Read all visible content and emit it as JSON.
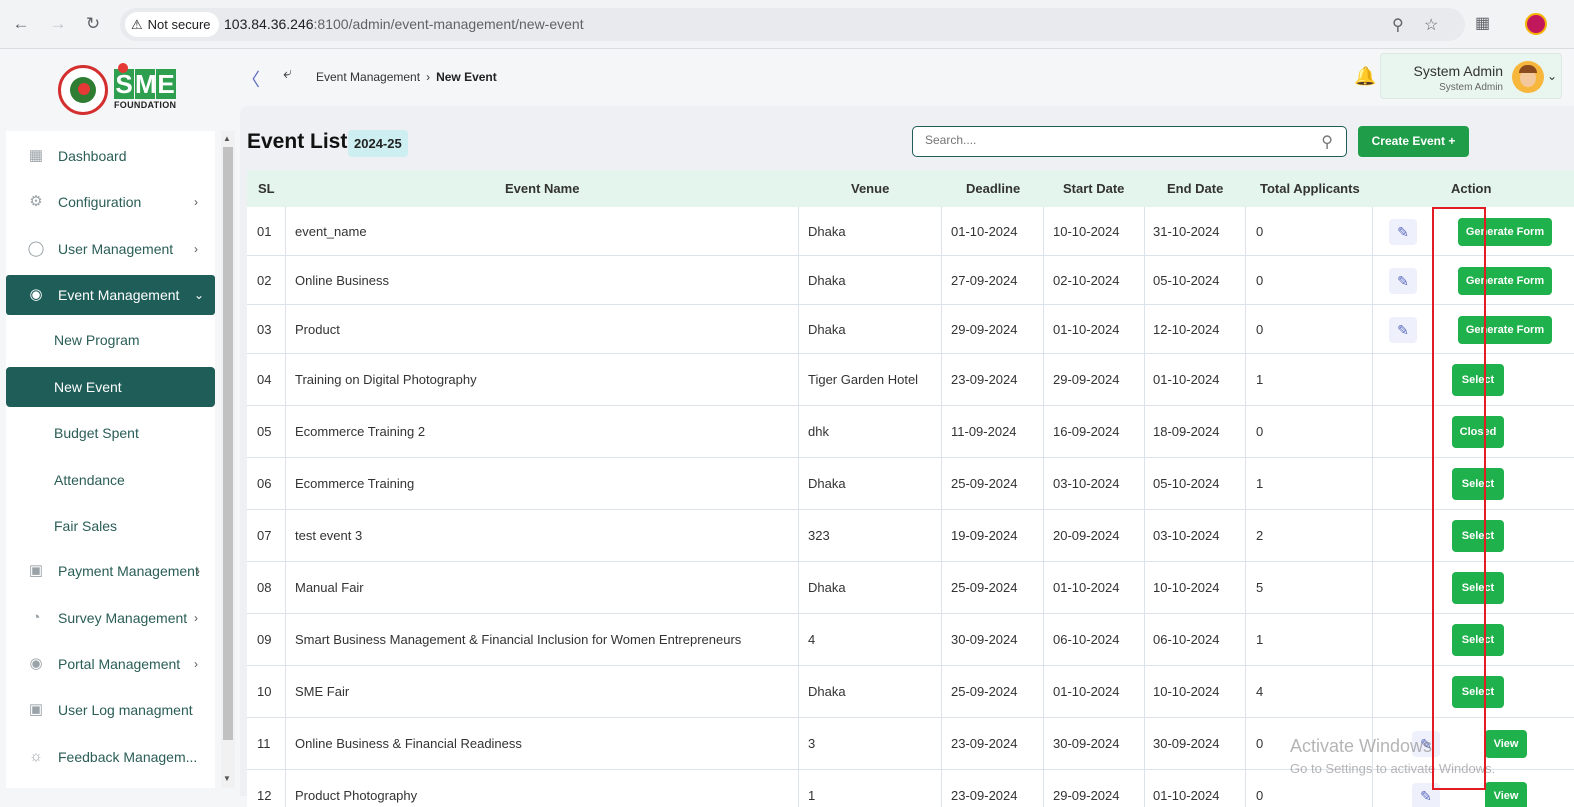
{
  "browser": {
    "security_label": "Not secure",
    "url_host": "103.84.36.246",
    "url_rest": ":8100/admin/event-management/new-event"
  },
  "brand": {
    "letters": [
      "S",
      "M",
      "E"
    ],
    "foundation": "FOUNDATION"
  },
  "header": {
    "breadcrumb_parent": "Event Management",
    "breadcrumb_current": "New Event",
    "user_name": "System Admin",
    "user_role": "System Admin"
  },
  "sidebar": {
    "items": [
      {
        "label": "Dashboard",
        "icon": "grid-icon"
      },
      {
        "label": "Configuration",
        "icon": "config-icon"
      },
      {
        "label": "User Management",
        "icon": "shield-icon"
      },
      {
        "label": "Event Management",
        "icon": "lock-icon"
      },
      {
        "label": "New Program"
      },
      {
        "label": "New Event"
      },
      {
        "label": "Budget Spent"
      },
      {
        "label": "Attendance"
      },
      {
        "label": "Fair Sales"
      },
      {
        "label": "Payment Management",
        "icon": "payment-icon"
      },
      {
        "label": "Survey Management",
        "icon": "pie-icon"
      },
      {
        "label": "Portal Management",
        "icon": "lock-icon"
      },
      {
        "label": "User Log managment",
        "icon": "log-icon"
      },
      {
        "label": "Feedback Managem...",
        "icon": "feedback-icon"
      }
    ]
  },
  "main": {
    "title": "Event List",
    "year": "2024-25",
    "search_placeholder": "Search....",
    "create_label": "Create Event +"
  },
  "table": {
    "headers": [
      "SL",
      "Event Name",
      "Venue",
      "Deadline",
      "Start Date",
      "End Date",
      "Total Applicants",
      "Action"
    ],
    "rows": [
      {
        "sl": "01",
        "name": "event_name",
        "venue": "Dhaka",
        "deadline": "01-10-2024",
        "start": "10-10-2024",
        "end": "31-10-2024",
        "applicants": "0",
        "action": "Generate Form",
        "edit": true
      },
      {
        "sl": "02",
        "name": "Online Business",
        "venue": "Dhaka",
        "deadline": "27-09-2024",
        "start": "02-10-2024",
        "end": "05-10-2024",
        "applicants": "0",
        "action": "Generate Form",
        "edit": true
      },
      {
        "sl": "03",
        "name": "Product",
        "venue": "Dhaka",
        "deadline": "29-09-2024",
        "start": "01-10-2024",
        "end": "12-10-2024",
        "applicants": "0",
        "action": "Generate Form",
        "edit": true
      },
      {
        "sl": "04",
        "name": "Training on Digital Photography",
        "venue": "Tiger Garden Hotel",
        "deadline": "23-09-2024",
        "start": "29-09-2024",
        "end": "01-10-2024",
        "applicants": "1",
        "action": "Select",
        "edit": false
      },
      {
        "sl": "05",
        "name": "Ecommerce Training 2",
        "venue": "dhk",
        "deadline": "11-09-2024",
        "start": "16-09-2024",
        "end": "18-09-2024",
        "applicants": "0",
        "action": "Closed",
        "edit": false
      },
      {
        "sl": "06",
        "name": "Ecommerce Training",
        "venue": "Dhaka",
        "deadline": "25-09-2024",
        "start": "03-10-2024",
        "end": "05-10-2024",
        "applicants": "1",
        "action": "Select",
        "edit": false
      },
      {
        "sl": "07",
        "name": "test event 3",
        "venue": "323",
        "deadline": "19-09-2024",
        "start": "20-09-2024",
        "end": "03-10-2024",
        "applicants": "2",
        "action": "Select",
        "edit": false
      },
      {
        "sl": "08",
        "name": "Manual Fair",
        "venue": "Dhaka",
        "deadline": "25-09-2024",
        "start": "01-10-2024",
        "end": "10-10-2024",
        "applicants": "5",
        "action": "Select",
        "edit": false
      },
      {
        "sl": "09",
        "name": "Smart Business Management & Financial Inclusion for Women Entrepreneurs",
        "venue": "4",
        "deadline": "30-09-2024",
        "start": "06-10-2024",
        "end": "06-10-2024",
        "applicants": "1",
        "action": "Select",
        "edit": false
      },
      {
        "sl": "10",
        "name": "SME Fair",
        "venue": "Dhaka",
        "deadline": "25-09-2024",
        "start": "01-10-2024",
        "end": "10-10-2024",
        "applicants": "4",
        "action": "Select",
        "edit": false
      },
      {
        "sl": "11",
        "name": "Online Business & Financial Readiness",
        "venue": "3",
        "deadline": "23-09-2024",
        "start": "30-09-2024",
        "end": "30-09-2024",
        "applicants": "0",
        "action": "View",
        "edit": true
      },
      {
        "sl": "12",
        "name": "Product Photography",
        "venue": "1",
        "deadline": "23-09-2024",
        "start": "29-09-2024",
        "end": "01-10-2024",
        "applicants": "0",
        "action": "View",
        "edit": true
      }
    ]
  },
  "watermark": {
    "line1": "Activate Windows",
    "line2": "Go to Settings to activate Windows."
  },
  "colors": {
    "primary": "#1f5d58",
    "button_green": "#1fb14b",
    "highlight_red": "#e31b23"
  }
}
